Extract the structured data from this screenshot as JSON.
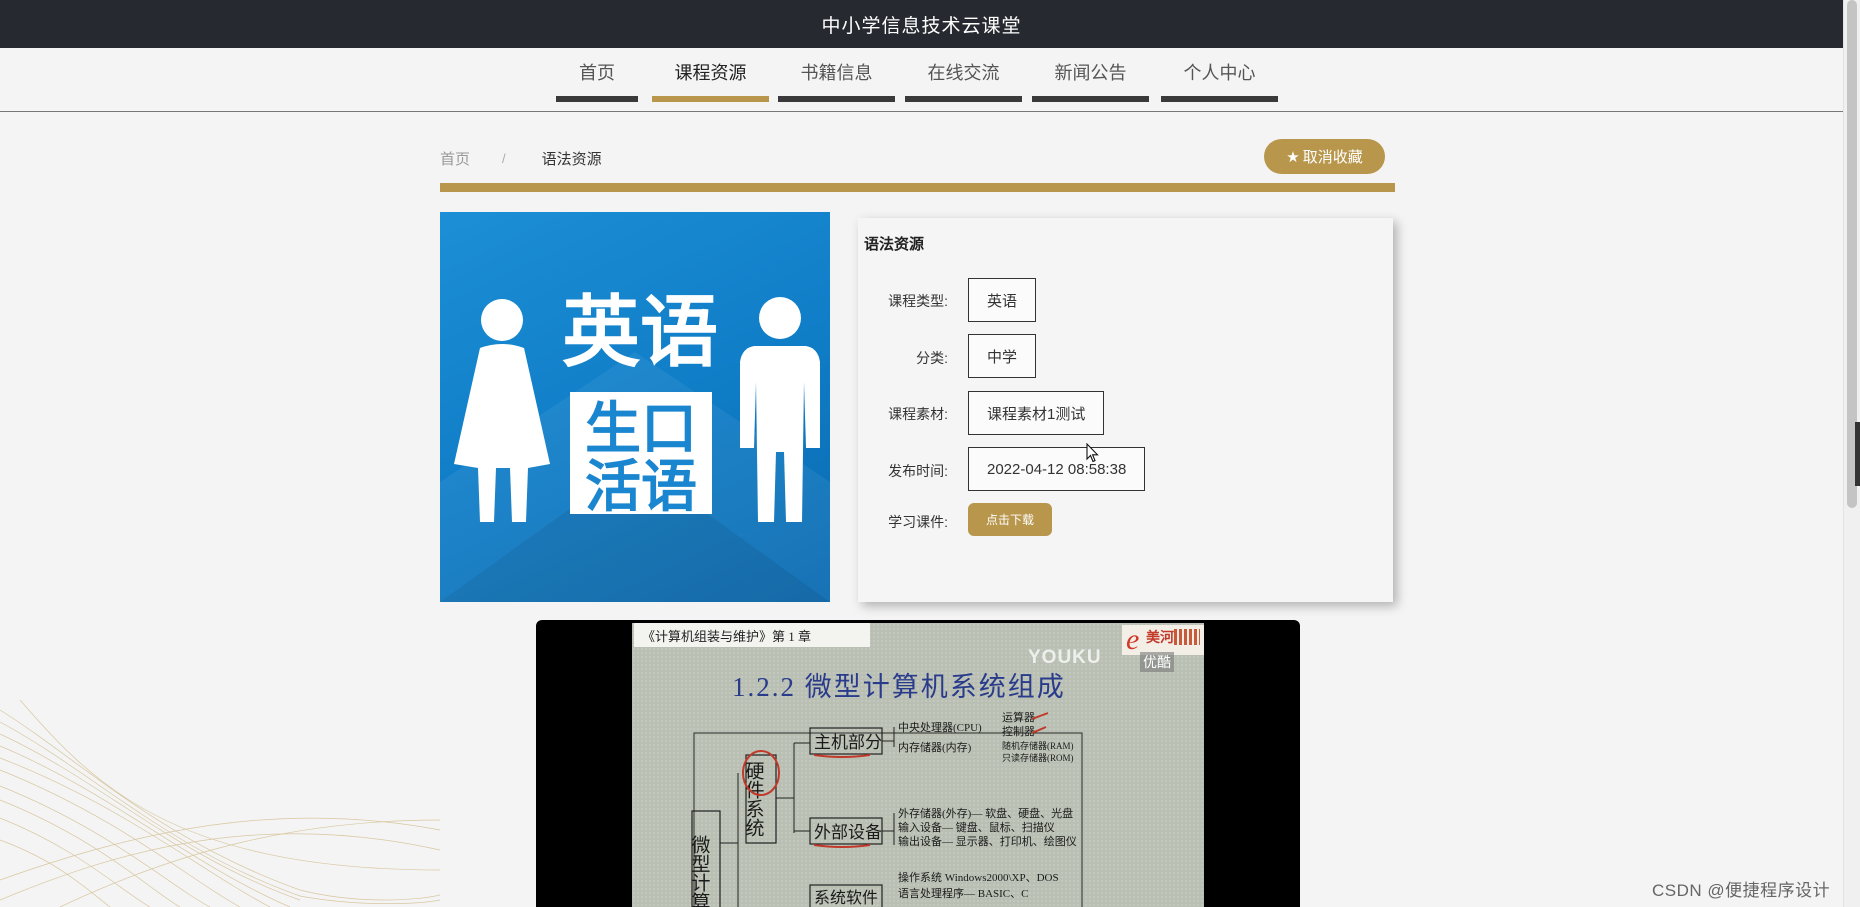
{
  "site_title": "中小学信息技术云课堂",
  "nav": [
    {
      "label": "首页"
    },
    {
      "label": "课程资源"
    },
    {
      "label": "书籍信息"
    },
    {
      "label": "在线交流"
    },
    {
      "label": "新闻公告"
    },
    {
      "label": "个人中心"
    }
  ],
  "active_nav": "课程资源",
  "breadcrumb": {
    "home": "首页",
    "separator": "/",
    "current": "语法资源"
  },
  "favorite_button": {
    "label": "取消收藏",
    "icon": "star-icon"
  },
  "cover_image": {
    "icon": "male-female-figures-icon",
    "line1": "英语",
    "line2a": "生口",
    "line2b": "活语"
  },
  "detail": {
    "title": "语法资源",
    "fields": [
      {
        "label": "课程类型:",
        "value": "英语"
      },
      {
        "label": "分类:",
        "value": "中学"
      },
      {
        "label": "课程素材:",
        "value": "课程素材1测试"
      },
      {
        "label": "发布时间:",
        "value": "2022-04-12 08:58:38"
      }
    ],
    "download_label": "学习课件:",
    "download_button": "点击下载"
  },
  "video": {
    "header": "《计算机组装与维护》第 1 章",
    "title": "1.2.2  微型计算机系统组成",
    "youku": "YOUKU",
    "youku_cn": "优酷",
    "logo_text": "美河",
    "diagram": {
      "root": "微型计算机",
      "hardware": "硬件系统",
      "host": "主机部分",
      "peripheral": "外部设备",
      "software": "系统软件",
      "cpu": "中央处理器(CPU)",
      "memory": "内存储器(内存)",
      "alu": "运算器",
      "cu": "控制器",
      "ram": "随机存储器(RAM)",
      "rom": "只读存储器(ROM)",
      "ext_storage": "外存储器(外存)— 软盘、硬盘、光盘",
      "input": "输入设备— 键盘、鼠标、扫描仪",
      "output": "输出设备— 显示器、打印机、绘图仪",
      "os": "操作系统    Windows2000\\XP、DOS",
      "lang": "语言处理程序— BASIC、C"
    }
  },
  "watermark": "CSDN @便捷程序设计"
}
